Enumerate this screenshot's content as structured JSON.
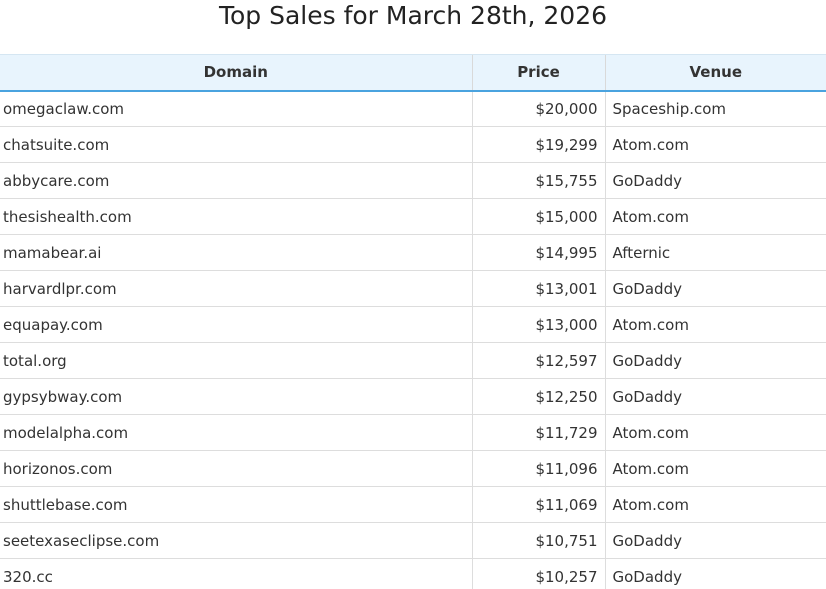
{
  "page": {
    "title": "Top Sales for March 28th, 2026"
  },
  "table": {
    "columns": {
      "domain": "Domain",
      "price": "Price",
      "venue": "Venue"
    },
    "rows": [
      {
        "domain": "omegaclaw.com",
        "price": "$20,000",
        "venue": "Spaceship.com"
      },
      {
        "domain": "chatsuite.com",
        "price": "$19,299",
        "venue": "Atom.com"
      },
      {
        "domain": "abbycare.com",
        "price": "$15,755",
        "venue": "GoDaddy"
      },
      {
        "domain": "thesishealth.com",
        "price": "$15,000",
        "venue": "Atom.com"
      },
      {
        "domain": "mamabear.ai",
        "price": "$14,995",
        "venue": "Afternic"
      },
      {
        "domain": "harvardlpr.com",
        "price": "$13,001",
        "venue": "GoDaddy"
      },
      {
        "domain": "equapay.com",
        "price": "$13,000",
        "venue": "Atom.com"
      },
      {
        "domain": "total.org",
        "price": "$12,597",
        "venue": "GoDaddy"
      },
      {
        "domain": "gypsybway.com",
        "price": "$12,250",
        "venue": "GoDaddy"
      },
      {
        "domain": "modelalpha.com",
        "price": "$11,729",
        "venue": "Atom.com"
      },
      {
        "domain": "horizonos.com",
        "price": "$11,096",
        "venue": "Atom.com"
      },
      {
        "domain": "shuttlebase.com",
        "price": "$11,069",
        "venue": "Atom.com"
      },
      {
        "domain": "seetexaseclipse.com",
        "price": "$10,751",
        "venue": "GoDaddy"
      },
      {
        "domain": "320.cc",
        "price": "$10,257",
        "venue": "GoDaddy"
      }
    ]
  }
}
